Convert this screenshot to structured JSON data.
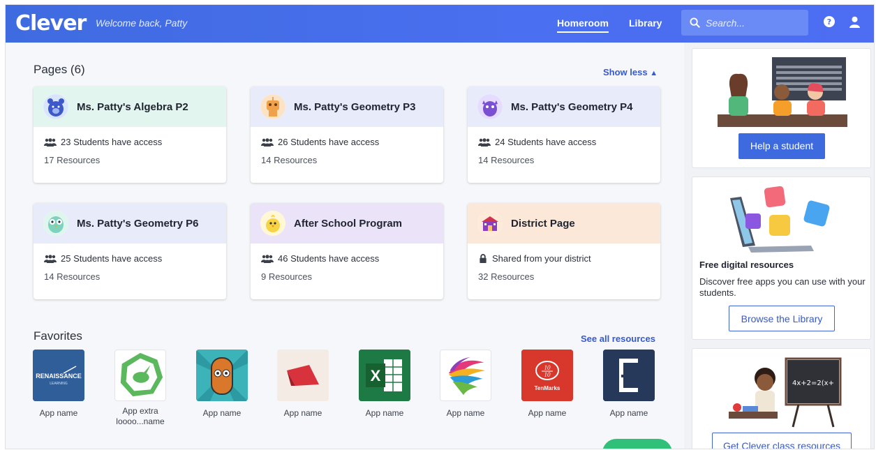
{
  "header": {
    "logo": "Clever",
    "welcome": "Welcome back, Patty",
    "nav": [
      {
        "label": "Homeroom",
        "active": true
      },
      {
        "label": "Library",
        "active": false
      }
    ],
    "search_placeholder": "Search...",
    "icons": [
      "search-icon",
      "help-icon",
      "user-icon"
    ],
    "accent": "#4a6ff0"
  },
  "pages": {
    "title": "Pages (6)",
    "toggle": "Show less",
    "cards": [
      {
        "title": "Ms. Patty's Algebra P2",
        "line1": "23 Students have access",
        "line2": "17 Resources",
        "color": "#e2f5ee",
        "line1_icon": "students-icon"
      },
      {
        "title": "Ms. Patty's Geometry P3",
        "line1": "26 Students have access",
        "line2": "14 Resources",
        "color": "#e8ecfa",
        "line1_icon": "students-icon"
      },
      {
        "title": "Ms. Patty's Geometry P4",
        "line1": "24 Students have access",
        "line2": "14 Resources",
        "color": "#e8ecfa",
        "line1_icon": "students-icon"
      },
      {
        "title": "Ms. Patty's Geometry P6",
        "line1": "25 Students have access",
        "line2": "14 Resources",
        "color": "#e8ecfa",
        "line1_icon": "students-icon"
      },
      {
        "title": "After School Program",
        "line1": "46 Students have access",
        "line2": "9 Resources",
        "color": "#ebe3f8",
        "line1_icon": "students-icon"
      },
      {
        "title": "District Page",
        "line1": "Shared from your district",
        "line2": "32 Resources",
        "color": "#fbe8d8",
        "line1_icon": "lock-icon"
      }
    ]
  },
  "favorites": {
    "title": "Favorites",
    "see_all": "See all resources",
    "apps": [
      {
        "name": "App name",
        "tile_text": "RENAISSANCE",
        "tile_sub": "LEARNING"
      },
      {
        "name": "App extra loooo...name"
      },
      {
        "name": "App name"
      },
      {
        "name": "App name"
      },
      {
        "name": "App name",
        "tile_text": "X"
      },
      {
        "name": "App name"
      },
      {
        "name": "App name",
        "tile_text": "TenMarks"
      },
      {
        "name": "App name"
      }
    ]
  },
  "sidebar": {
    "help_button": "Help a student",
    "free_title": "Free digital resources",
    "free_desc": "Discover free apps you can use with your students.",
    "browse_button": "Browse the Library",
    "class_button": "Get Clever class resources",
    "chalkboard_text": "4x+2=2(x+"
  }
}
